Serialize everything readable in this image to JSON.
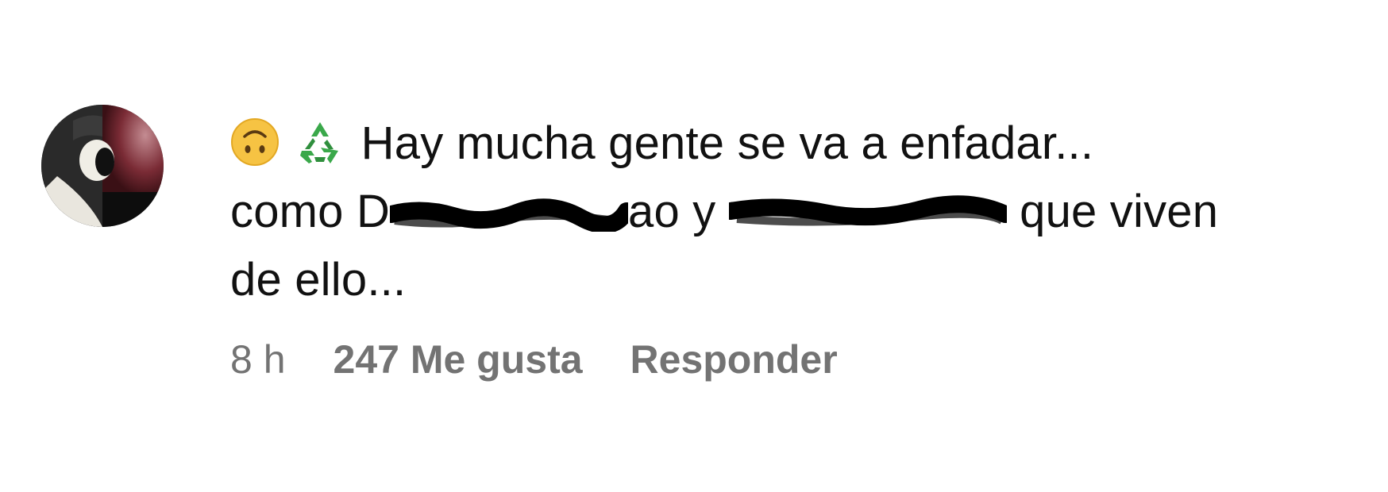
{
  "comment": {
    "avatar_icon": "user-avatar",
    "emojis": [
      "upside-down-face-emoji",
      "recycle-emoji"
    ],
    "line1_text": "Hay mucha gente se va a enfadar...",
    "line2_part1": "como D",
    "line2_part2": "ao y",
    "line2_part3": "que viven",
    "line3_text": "de ello...",
    "redaction_color": "#000000"
  },
  "meta": {
    "time": "8 h",
    "likes": "247 Me gusta",
    "reply": "Responder",
    "color": "#737373"
  }
}
